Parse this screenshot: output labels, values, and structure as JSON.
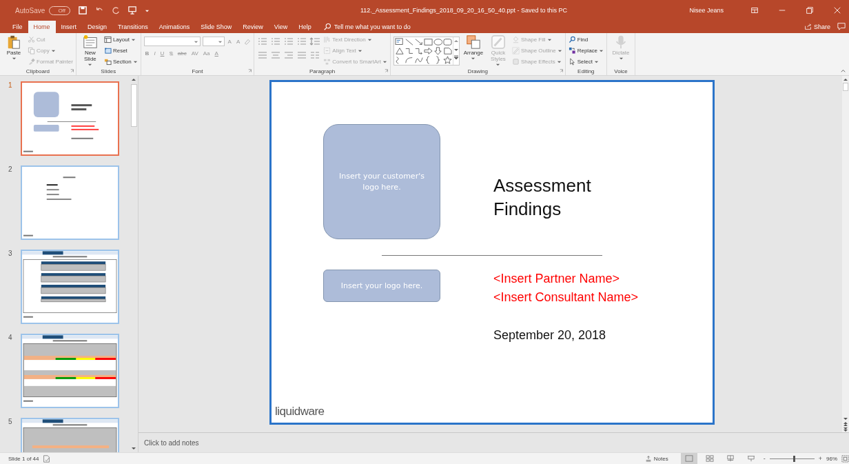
{
  "title_bar": {
    "autosave_label": "AutoSave",
    "autosave_state": "Off",
    "autosave_on": false,
    "document": "112._Assessment_Findings_2018_09_20_16_50_40.ppt  -  Saved to this PC",
    "user": "Nisee Jeans"
  },
  "menu_tabs": [
    {
      "label": "File",
      "selected": false
    },
    {
      "label": "Home",
      "selected": true
    },
    {
      "label": "Insert",
      "selected": false
    },
    {
      "label": "Design",
      "selected": false
    },
    {
      "label": "Transitions",
      "selected": false
    },
    {
      "label": "Animations",
      "selected": false
    },
    {
      "label": "Slide Show",
      "selected": false
    },
    {
      "label": "Review",
      "selected": false
    },
    {
      "label": "View",
      "selected": false
    },
    {
      "label": "Help",
      "selected": false
    }
  ],
  "tell_me": "Tell me what you want to do",
  "share": "Share",
  "ribbon": {
    "groups": [
      {
        "label": "Clipboard",
        "launcher": true,
        "columns": [
          [
            {
              "kind": "large",
              "label": "Paste",
              "disabled": false,
              "dropdown": true
            }
          ],
          [
            {
              "kind": "small",
              "label": "Cut",
              "disabled": true,
              "dropdown": false
            },
            {
              "kind": "small",
              "label": "Copy",
              "disabled": true,
              "dropdown": true
            },
            {
              "kind": "small",
              "label": "Format Painter",
              "disabled": true,
              "dropdown": false
            }
          ]
        ]
      },
      {
        "label": "Slides",
        "launcher": false,
        "columns": [
          [
            {
              "kind": "large",
              "label": "New Slide",
              "disabled": false,
              "dropdown": true
            }
          ],
          [
            {
              "kind": "small",
              "label": "Layout",
              "disabled": false,
              "dropdown": true
            },
            {
              "kind": "small",
              "label": "Reset",
              "disabled": false,
              "dropdown": false
            },
            {
              "kind": "small",
              "label": "Section",
              "disabled": false,
              "dropdown": true
            }
          ]
        ]
      },
      {
        "label": "Font",
        "launcher": true,
        "columns": [
          [
            {
              "kind": "font-tools",
              "size_glyphs": [
                "A",
                "A"
              ],
              "glyphs": [
                "B",
                "I",
                "U",
                "S",
                "abc",
                "AV",
                "Aa",
                "A"
              ]
            }
          ]
        ]
      },
      {
        "label": "Paragraph",
        "launcher": true,
        "columns": [
          [
            {
              "kind": "paragraph-tools"
            }
          ],
          [
            {
              "kind": "small",
              "label": "Text Direction",
              "disabled": true,
              "dropdown": true
            },
            {
              "kind": "small",
              "label": "Align Text",
              "disabled": true,
              "dropdown": true
            },
            {
              "kind": "small",
              "label": "Convert to SmartArt",
              "disabled": true,
              "dropdown": true
            }
          ]
        ]
      },
      {
        "label": "Drawing",
        "launcher": true,
        "columns": [
          [
            {
              "kind": "gallery"
            }
          ],
          [
            {
              "kind": "large",
              "label": "Arrange",
              "disabled": false,
              "dropdown": true
            }
          ],
          [
            {
              "kind": "large",
              "label": "Quick Styles",
              "disabled": true,
              "dropdown": true
            }
          ],
          [
            {
              "kind": "small",
              "label": "Shape Fill",
              "disabled": true,
              "dropdown": true
            },
            {
              "kind": "small",
              "label": "Shape Outline",
              "disabled": true,
              "dropdown": true
            },
            {
              "kind": "small",
              "label": "Shape Effects",
              "disabled": true,
              "dropdown": true
            }
          ]
        ]
      },
      {
        "label": "Editing",
        "launcher": false,
        "columns": [
          [
            {
              "kind": "small",
              "label": "Find",
              "disabled": false,
              "dropdown": false
            },
            {
              "kind": "small",
              "label": "Replace",
              "disabled": false,
              "dropdown": true
            },
            {
              "kind": "small",
              "label": "Select",
              "disabled": false,
              "dropdown": true
            }
          ]
        ]
      },
      {
        "label": "Voice",
        "launcher": false,
        "columns": [
          [
            {
              "kind": "large",
              "label": "Dictate",
              "disabled": true,
              "dropdown": true
            }
          ]
        ]
      }
    ]
  },
  "thumbnails": [
    {
      "number": "1",
      "selected": true,
      "kind": "title"
    },
    {
      "number": "2",
      "selected": false,
      "kind": "agenda"
    },
    {
      "number": "3",
      "selected": false,
      "kind": "scope-table"
    },
    {
      "number": "4",
      "selected": false,
      "kind": "profile-table"
    },
    {
      "number": "5",
      "selected": false,
      "kind": "count-table"
    }
  ],
  "slide": {
    "customer_logo": "Insert your customer's logo here.",
    "title": "Assessment Findings",
    "own_logo": "Insert your logo here.",
    "partner": "<Insert Partner Name>",
    "consultant": "<Insert Consultant Name>",
    "date": "September 20, 2018",
    "footer": "liquidware"
  },
  "notes_placeholder": "Click to add notes",
  "status_bar": {
    "slide_count": "Slide 1 of 44",
    "notes": "Notes",
    "views": [
      {
        "selected": true
      },
      {
        "selected": false
      },
      {
        "selected": false
      },
      {
        "selected": false
      }
    ],
    "zoom_out": "-",
    "zoom_slider": {
      "level": 0.54
    },
    "zoom_in": "+",
    "zoom": "96%"
  }
}
